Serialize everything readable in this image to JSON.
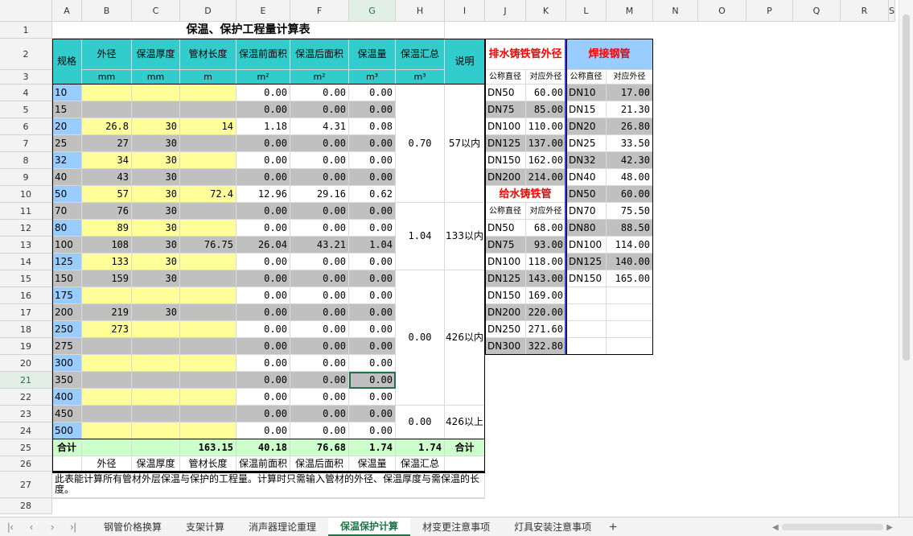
{
  "col_headers": [
    "A",
    "B",
    "C",
    "D",
    "E",
    "F",
    "G",
    "H",
    "I",
    "J",
    "K",
    "L",
    "M",
    "N",
    "O",
    "P",
    "Q",
    "R",
    "S"
  ],
  "row_headers": [
    "1",
    "2",
    "3",
    "4",
    "5",
    "6",
    "7",
    "8",
    "9",
    "10",
    "11",
    "12",
    "13",
    "14",
    "15",
    "16",
    "17",
    "18",
    "19",
    "20",
    "21",
    "22",
    "23",
    "24",
    "25",
    "26",
    "27",
    "28"
  ],
  "selected": {
    "col": "G",
    "row": "21"
  },
  "title": "保温、保护工程量计算表",
  "head": {
    "spec": "规格",
    "od": "外径",
    "thickness": "保温厚度",
    "length": "管材长度",
    "front_area": "保温前面积",
    "back_area": "保温后面积",
    "volume": "保温量",
    "total": "保温汇总",
    "note": "说明"
  },
  "units": {
    "od": "mm",
    "thickness": "mm",
    "length": "m",
    "front_area": "m²",
    "back_area": "m²",
    "volume": "m³",
    "total": "m³"
  },
  "rows": [
    {
      "spec": "10",
      "od": "",
      "th": "",
      "len": "",
      "fa": "0.00",
      "ba": "0.00",
      "vol": "0.00"
    },
    {
      "spec": "15",
      "od": "",
      "th": "",
      "len": "",
      "fa": "0.00",
      "ba": "0.00",
      "vol": "0.00"
    },
    {
      "spec": "20",
      "od": "26.8",
      "th": "30",
      "len": "14",
      "fa": "1.18",
      "ba": "4.31",
      "vol": "0.08"
    },
    {
      "spec": "25",
      "od": "27",
      "th": "30",
      "len": "",
      "fa": "0.00",
      "ba": "0.00",
      "vol": "0.00"
    },
    {
      "spec": "32",
      "od": "34",
      "th": "30",
      "len": "",
      "fa": "0.00",
      "ba": "0.00",
      "vol": "0.00"
    },
    {
      "spec": "40",
      "od": "43",
      "th": "30",
      "len": "",
      "fa": "0.00",
      "ba": "0.00",
      "vol": "0.00"
    },
    {
      "spec": "50",
      "od": "57",
      "th": "30",
      "len": "72.4",
      "fa": "12.96",
      "ba": "29.16",
      "vol": "0.62"
    },
    {
      "spec": "70",
      "od": "76",
      "th": "30",
      "len": "",
      "fa": "0.00",
      "ba": "0.00",
      "vol": "0.00"
    },
    {
      "spec": "80",
      "od": "89",
      "th": "30",
      "len": "",
      "fa": "0.00",
      "ba": "0.00",
      "vol": "0.00"
    },
    {
      "spec": "100",
      "od": "108",
      "th": "30",
      "len": "76.75",
      "fa": "26.04",
      "ba": "43.21",
      "vol": "1.04"
    },
    {
      "spec": "125",
      "od": "133",
      "th": "30",
      "len": "",
      "fa": "0.00",
      "ba": "0.00",
      "vol": "0.00"
    },
    {
      "spec": "150",
      "od": "159",
      "th": "30",
      "len": "",
      "fa": "0.00",
      "ba": "0.00",
      "vol": "0.00"
    },
    {
      "spec": "175",
      "od": "",
      "th": "",
      "len": "",
      "fa": "0.00",
      "ba": "0.00",
      "vol": "0.00"
    },
    {
      "spec": "200",
      "od": "219",
      "th": "30",
      "len": "",
      "fa": "0.00",
      "ba": "0.00",
      "vol": "0.00"
    },
    {
      "spec": "250",
      "od": "273",
      "th": "",
      "len": "",
      "fa": "0.00",
      "ba": "0.00",
      "vol": "0.00"
    },
    {
      "spec": "275",
      "od": "",
      "th": "",
      "len": "",
      "fa": "0.00",
      "ba": "0.00",
      "vol": "0.00"
    },
    {
      "spec": "300",
      "od": "",
      "th": "",
      "len": "",
      "fa": "0.00",
      "ba": "0.00",
      "vol": "0.00"
    },
    {
      "spec": "350",
      "od": "",
      "th": "",
      "len": "",
      "fa": "0.00",
      "ba": "0.00",
      "vol": "0.00"
    },
    {
      "spec": "400",
      "od": "",
      "th": "",
      "len": "",
      "fa": "0.00",
      "ba": "0.00",
      "vol": "0.00"
    },
    {
      "spec": "450",
      "od": "",
      "th": "",
      "len": "",
      "fa": "0.00",
      "ba": "0.00",
      "vol": "0.00"
    },
    {
      "spec": "500",
      "od": "",
      "th": "",
      "len": "",
      "fa": "0.00",
      "ba": "0.00",
      "vol": "0.00"
    }
  ],
  "groups": [
    {
      "total": "0.70",
      "note": "57以内"
    },
    {
      "total": "1.04",
      "note": "133以内"
    },
    {
      "total": "0.00",
      "note": "426以内"
    },
    {
      "total": "0.00",
      "note": "426以上"
    }
  ],
  "sum_row": {
    "label": "合计",
    "len": "163.15",
    "fa": "40.18",
    "ba": "76.68",
    "vol": "1.74",
    "total": "1.74",
    "note": "合计"
  },
  "row26": {
    "od": "外径",
    "th": "保温厚度",
    "len": "管材长度",
    "fa": "保温前面积",
    "ba": "保温后面积",
    "vol": "保温量",
    "total": "保温汇总"
  },
  "desc": "此表能计算所有管材外层保温与保护的工程量。计算时只需输入管材的外径、保温厚度与需保温的长度。",
  "drain_cast_iron": {
    "title": "排水铸铁管外径",
    "col_nominal": "公称直径",
    "col_od": "对应外径",
    "rows": [
      [
        "DN50",
        "60.00"
      ],
      [
        "DN75",
        "85.00"
      ],
      [
        "DN100",
        "110.00"
      ],
      [
        "DN125",
        "137.00"
      ],
      [
        "DN150",
        "162.00"
      ],
      [
        "DN200",
        "214.00"
      ]
    ]
  },
  "supply_cast_iron": {
    "title": "给水铸铁管",
    "col_nominal": "公称直径",
    "col_od": "对应外径",
    "rows": [
      [
        "DN50",
        "68.00"
      ],
      [
        "DN75",
        "93.00"
      ],
      [
        "DN100",
        "118.00"
      ],
      [
        "DN125",
        "143.00"
      ],
      [
        "DN150",
        "169.00"
      ],
      [
        "DN200",
        "220.00"
      ],
      [
        "DN250",
        "271.60"
      ],
      [
        "DN300",
        "322.80"
      ]
    ]
  },
  "welded_steel": {
    "title": "焊接钢管",
    "col_nominal": "公称直径",
    "col_od": "对应外径",
    "rows": [
      [
        "DN10",
        "17.00"
      ],
      [
        "DN15",
        "21.30"
      ],
      [
        "DN20",
        "26.80"
      ],
      [
        "DN25",
        "33.50"
      ],
      [
        "DN32",
        "42.30"
      ],
      [
        "DN40",
        "48.00"
      ],
      [
        "DN50",
        "60.00"
      ],
      [
        "DN70",
        "75.50"
      ],
      [
        "DN80",
        "88.50"
      ],
      [
        "DN100",
        "114.00"
      ],
      [
        "DN125",
        "140.00"
      ],
      [
        "DN150",
        "165.00"
      ]
    ]
  },
  "sheet_tabs": [
    "钢管价格换算",
    "支架计算",
    "消声器理论重理",
    "保温保护计算",
    "材变更注意事项",
    "灯具安装注意事项"
  ],
  "active_tab": "保温保护计算",
  "colors": {
    "cyan": "#33cccc",
    "yellow": "#ffff99",
    "gray": "#c0c0c0",
    "blue": "#99ccff",
    "green": "#ccffcc",
    "red": "#ff0000",
    "accent": "#217346"
  }
}
